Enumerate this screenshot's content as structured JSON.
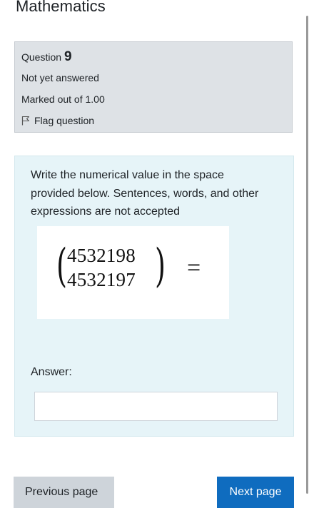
{
  "page": {
    "title": "Mathematics"
  },
  "question_info": {
    "question_label": "Question",
    "question_number": "9",
    "state": "Not yet answered",
    "grade": "Marked out of 1.00",
    "flag_label": "Flag question",
    "flag_icon": "flag-icon"
  },
  "question": {
    "text": "Write the numerical value in the space provided below. Sentences, words, and other expressions are not accepted",
    "math": {
      "top": "4532198",
      "bottom": "4532197",
      "relation": "="
    },
    "answer_label": "Answer:",
    "answer_value": "",
    "answer_placeholder": ""
  },
  "navigation": {
    "previous_label": "Previous page",
    "next_label": "Next page"
  },
  "colors": {
    "info_bg": "#dee2e6",
    "content_bg": "#e6f4f8",
    "next_button": "#0f6cbf",
    "prev_button": "#ced4da"
  }
}
